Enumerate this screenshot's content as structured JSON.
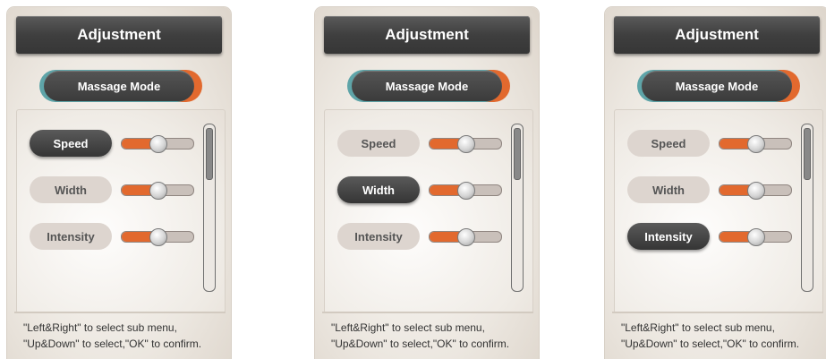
{
  "panels": [
    {
      "title": "Adjustment",
      "mode_label": "Massage Mode",
      "rows": [
        {
          "label": "Speed",
          "value": 0.5,
          "active": true
        },
        {
          "label": "Width",
          "value": 0.5,
          "active": false
        },
        {
          "label": "Intensity",
          "value": 0.5,
          "active": false
        }
      ],
      "hint_line1": "\"Left&Right\" to select sub menu,",
      "hint_line2": "\"Up&Down\" to select,\"OK\" to confirm."
    },
    {
      "title": "Adjustment",
      "mode_label": "Massage Mode",
      "rows": [
        {
          "label": "Speed",
          "value": 0.5,
          "active": false
        },
        {
          "label": "Width",
          "value": 0.5,
          "active": true
        },
        {
          "label": "Intensity",
          "value": 0.5,
          "active": false
        }
      ],
      "hint_line1": "\"Left&Right\" to select sub menu,",
      "hint_line2": "\"Up&Down\" to select,\"OK\" to confirm."
    },
    {
      "title": "Adjustment",
      "mode_label": "Massage Mode",
      "rows": [
        {
          "label": "Speed",
          "value": 0.5,
          "active": false
        },
        {
          "label": "Width",
          "value": 0.5,
          "active": false
        },
        {
          "label": "Intensity",
          "value": 0.5,
          "active": true
        }
      ],
      "hint_line1": "\"Left&Right\" to select sub menu,",
      "hint_line2": "\"Up&Down\" to select,\"OK\" to confirm."
    }
  ],
  "colors": {
    "accent_orange": "#e2692e",
    "accent_teal": "#5ea4a8",
    "dark_button": "#3f3f3f"
  }
}
